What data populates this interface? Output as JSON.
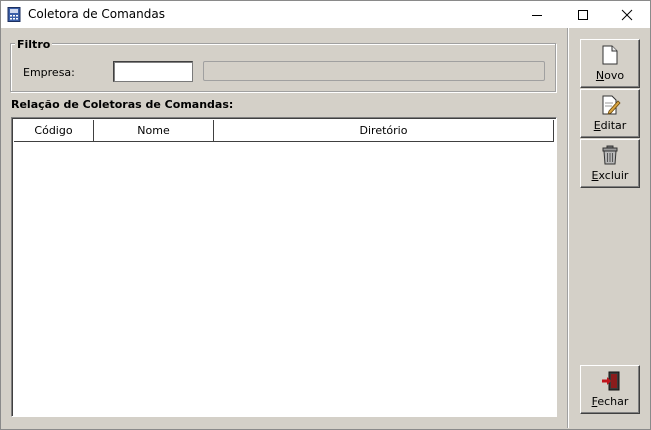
{
  "window": {
    "title": "Coletora de Comandas",
    "controls": [
      "minimize",
      "maximize",
      "close"
    ],
    "app_icon": "app-icon"
  },
  "filter": {
    "group_title": "Filtro",
    "empresa_label": "Empresa:",
    "empresa_value": "",
    "empresa_description": ""
  },
  "list": {
    "title": "Relação de Coletoras de Comandas:",
    "columns": [
      "Código",
      "Nome",
      "Diretório"
    ],
    "rows": []
  },
  "actions": {
    "novo": {
      "accel": "N",
      "rest": "ovo",
      "icon": "new-document-icon"
    },
    "editar": {
      "accel": "E",
      "rest": "ditar",
      "icon": "edit-document-icon"
    },
    "excluir": {
      "accel": "E",
      "rest": "xcluir",
      "icon": "trash-can-icon"
    },
    "fechar": {
      "accel": "F",
      "rest": "echar",
      "icon": "exit-door-icon"
    }
  }
}
